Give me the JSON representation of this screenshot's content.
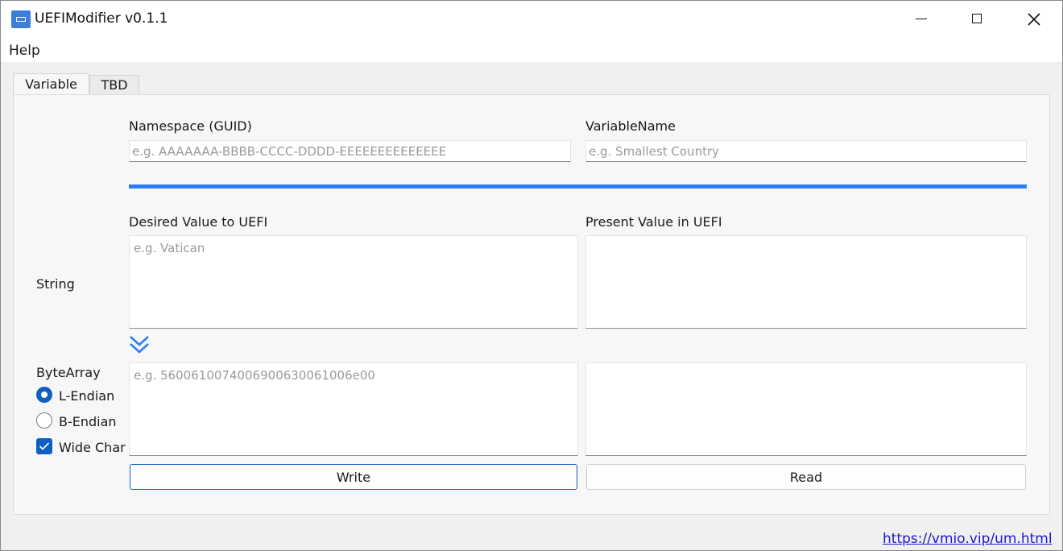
{
  "window": {
    "title": "UEFIModifier v0.1.1"
  },
  "menu": {
    "help_label": "Help"
  },
  "tabs": [
    {
      "label": "Variable",
      "active": true
    },
    {
      "label": "TBD",
      "active": false
    }
  ],
  "variable": {
    "namespace_label": "Namespace (GUID)",
    "namespace_placeholder": "e.g. AAAAAAA-BBBB-CCCC-DDDD-EEEEEEEEEEEEEE",
    "namespace_value": "",
    "name_label": "VariableName",
    "name_placeholder": "e.g. Smallest Country",
    "name_value": "",
    "desired_label": "Desired Value to UEFI",
    "present_label": "Present Value in UEFI",
    "string_row_label": "String",
    "string_desired_placeholder": "e.g. Vatican",
    "string_present_value": "",
    "bytearray_row_label": "ByteArray",
    "bytearray_desired_placeholder": "e.g. 5600610074006900630061006e00",
    "bytearray_present_value": "",
    "endian_options": [
      {
        "label": "L-Endian",
        "selected": true
      },
      {
        "label": "B-Endian",
        "selected": false
      }
    ],
    "wide_char_label": "Wide Char",
    "wide_char_checked": true,
    "write_label": "Write",
    "read_label": "Read"
  },
  "footer": {
    "link_text": "https://vmio.vip/um.html"
  },
  "colors": {
    "accent": "#2d7ff0",
    "control_blue": "#0e5fbf",
    "link": "#1a18d6"
  }
}
